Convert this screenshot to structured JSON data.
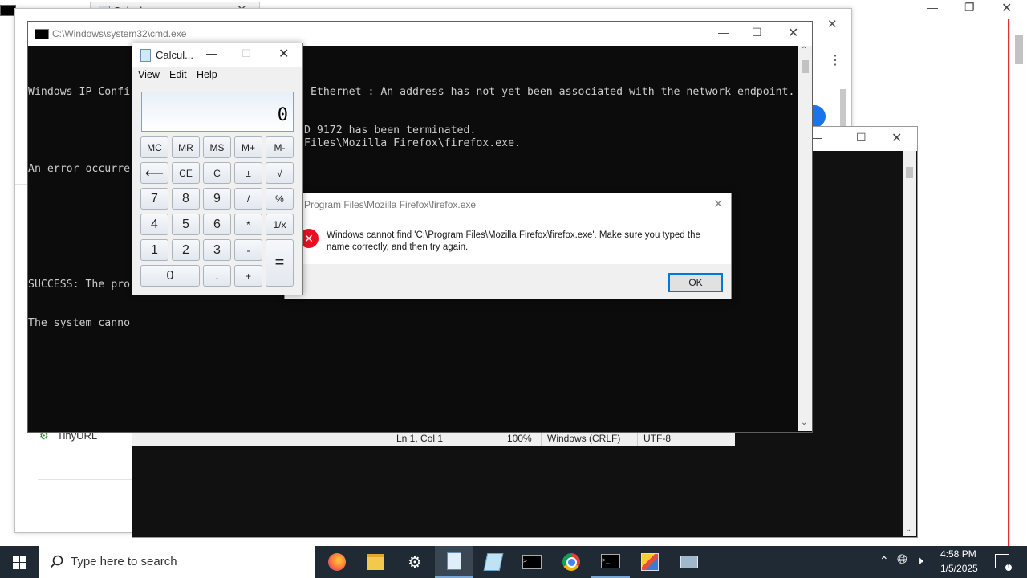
{
  "backdrop": {
    "tab_label": "Calcul...",
    "tinyurl_label": "TinyURL",
    "status_bar": {
      "position": "Ln 1, Col 1",
      "zoom": "100%",
      "line_ending": "Windows (CRLF)",
      "encoding": "UTF-8"
    }
  },
  "cmd": {
    "title": "C:\\Windows\\system32\\cmd.exe",
    "lines": [
      "Windows IP Confi",
      "",
      "An error occurre",
      "",
      "",
      "SUCCESS: The pro",
      "The system canno"
    ],
    "line_right_1": "Ethernet : An address has not yet been associated with the network endpoint.",
    "line_right_2": "D 9172 has been terminated.",
    "line_right_3": "Files\\Mozilla Firefox\\firefox.exe."
  },
  "calculator": {
    "title": "Calcul...",
    "menu": [
      "View",
      "Edit",
      "Help"
    ],
    "display": "0",
    "rows": [
      [
        "MC",
        "MR",
        "MS",
        "M+",
        "M-"
      ],
      [
        "⟵",
        "CE",
        "C",
        "±",
        "√"
      ],
      [
        "7",
        "8",
        "9",
        "/",
        "%"
      ],
      [
        "4",
        "5",
        "6",
        "*",
        "1/x"
      ],
      [
        "1",
        "2",
        "3",
        "-",
        "="
      ],
      [
        "0",
        ".",
        "+"
      ]
    ]
  },
  "dialog": {
    "title": "Program Files\\Mozilla Firefox\\firefox.exe",
    "message_line1": "Windows cannot find 'C:\\Program Files\\Mozilla Firefox\\firefox.exe'. Make sure you typed the",
    "message_line2": "name correctly, and then try again.",
    "ok_label": "OK"
  },
  "taskbar": {
    "search_placeholder": "Type here to search",
    "time": "4:58 PM",
    "date": "1/5/2025",
    "icons": [
      "firefox-icon",
      "file-explorer-icon",
      "settings-icon",
      "notepad-icon",
      "paint-icon",
      "cmd-icon",
      "chrome-icon",
      "cmd-icon",
      "paint-app-icon",
      "network-app-icon"
    ]
  },
  "colors": {
    "taskbar": "#1f2a35",
    "error": "#e81123",
    "accent": "#0078d7"
  }
}
